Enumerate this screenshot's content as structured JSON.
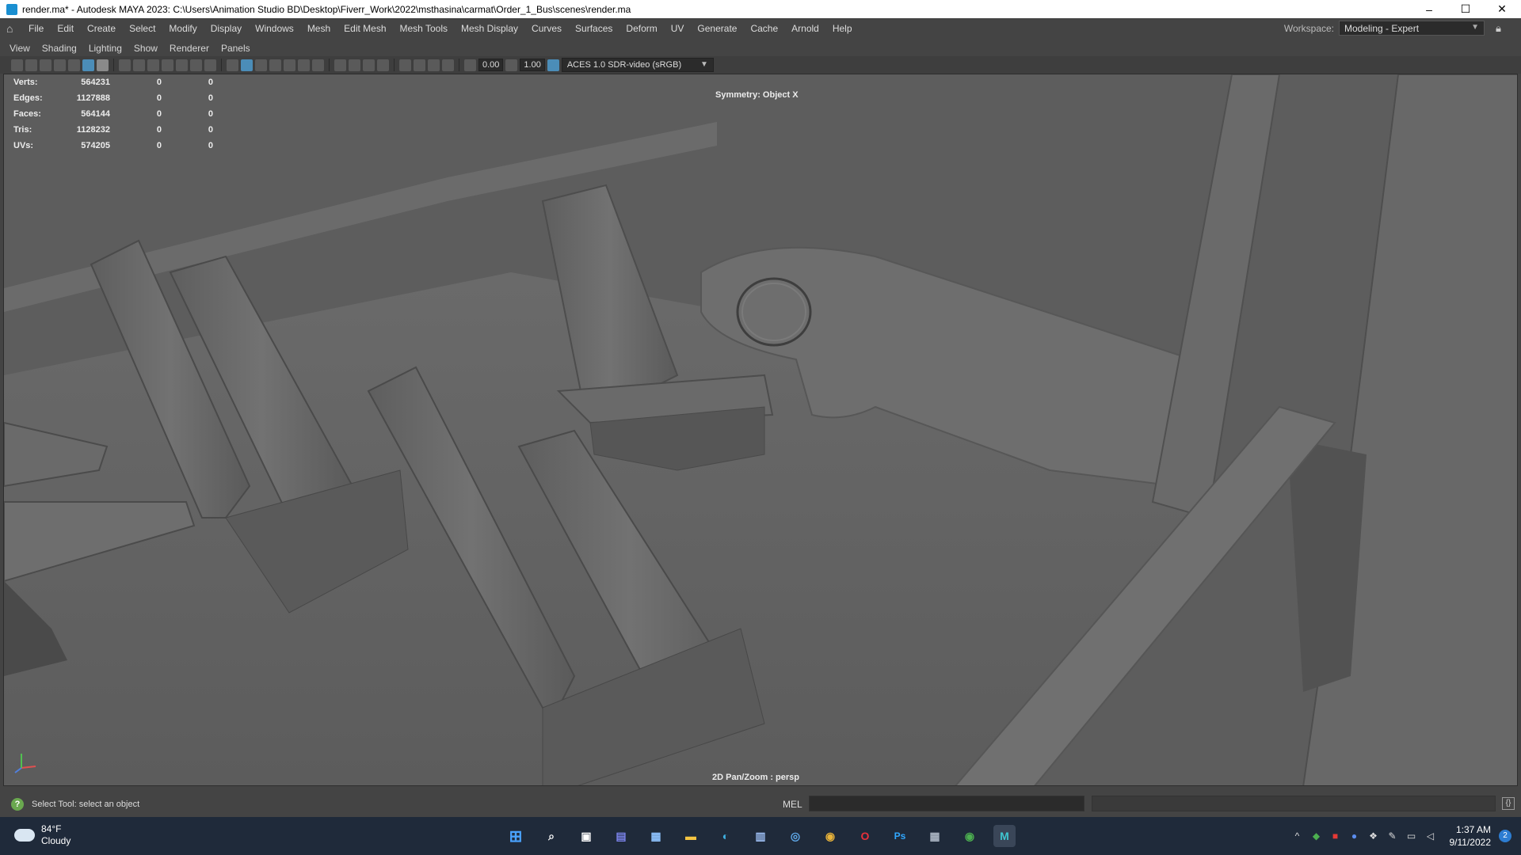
{
  "window": {
    "title": "render.ma* - Autodesk MAYA 2023: C:\\Users\\Animation Studio BD\\Desktop\\Fiverr_Work\\2022\\msthasina\\carmat\\Order_1_Bus\\scenes\\render.ma",
    "minimize": "–",
    "maximize": "☐",
    "close": "✕"
  },
  "menubar": {
    "items": [
      "File",
      "Edit",
      "Create",
      "Select",
      "Modify",
      "Display",
      "Windows",
      "Mesh",
      "Edit Mesh",
      "Mesh Tools",
      "Mesh Display",
      "Curves",
      "Surfaces",
      "Deform",
      "UV",
      "Generate",
      "Cache",
      "Arnold",
      "Help"
    ],
    "workspace_label": "Workspace:",
    "workspace_value": "Modeling - Expert"
  },
  "panel_menu": {
    "items": [
      "View",
      "Shading",
      "Lighting",
      "Show",
      "Renderer",
      "Panels"
    ]
  },
  "panel_toolbar": {
    "exposure": "0.00",
    "gamma": "1.00",
    "colorspace": "ACES 1.0 SDR-video (sRGB)"
  },
  "hud": {
    "rows": [
      {
        "label": "Verts:",
        "value": "564231",
        "sel": "0",
        "comp": "0"
      },
      {
        "label": "Edges:",
        "value": "1127888",
        "sel": "0",
        "comp": "0"
      },
      {
        "label": "Faces:",
        "value": "564144",
        "sel": "0",
        "comp": "0"
      },
      {
        "label": "Tris:",
        "value": "1128232",
        "sel": "0",
        "comp": "0"
      },
      {
        "label": "UVs:",
        "value": "574205",
        "sel": "0",
        "comp": "0"
      }
    ],
    "symmetry": "Symmetry: Object X",
    "camera": "2D Pan/Zoom : persp"
  },
  "command_line": {
    "help_text": "Select Tool: select an object",
    "mel_label": "MEL"
  },
  "taskbar": {
    "temperature": "84°F",
    "condition": "Cloudy",
    "time": "1:37 AM",
    "date": "9/11/2022",
    "notifications": "2",
    "apps": [
      {
        "name": "start-icon",
        "glyph": "⊞"
      },
      {
        "name": "search-icon",
        "glyph": "⌕"
      },
      {
        "name": "task-view-icon",
        "glyph": "▣"
      },
      {
        "name": "teams-icon",
        "glyph": "▤"
      },
      {
        "name": "photos-icon",
        "glyph": "▦"
      },
      {
        "name": "file-explorer-icon",
        "glyph": "▬"
      },
      {
        "name": "edge-icon",
        "glyph": "◐"
      },
      {
        "name": "store-icon",
        "glyph": "▥"
      },
      {
        "name": "settings-app-icon",
        "glyph": "◎"
      },
      {
        "name": "chrome-icon",
        "glyph": "◉"
      },
      {
        "name": "opera-icon",
        "glyph": "O"
      },
      {
        "name": "photoshop-icon",
        "glyph": "Ps"
      },
      {
        "name": "calculator-icon",
        "glyph": "▦"
      },
      {
        "name": "chrome-profile-icon",
        "glyph": "◉"
      },
      {
        "name": "maya-icon",
        "glyph": "M"
      }
    ]
  }
}
